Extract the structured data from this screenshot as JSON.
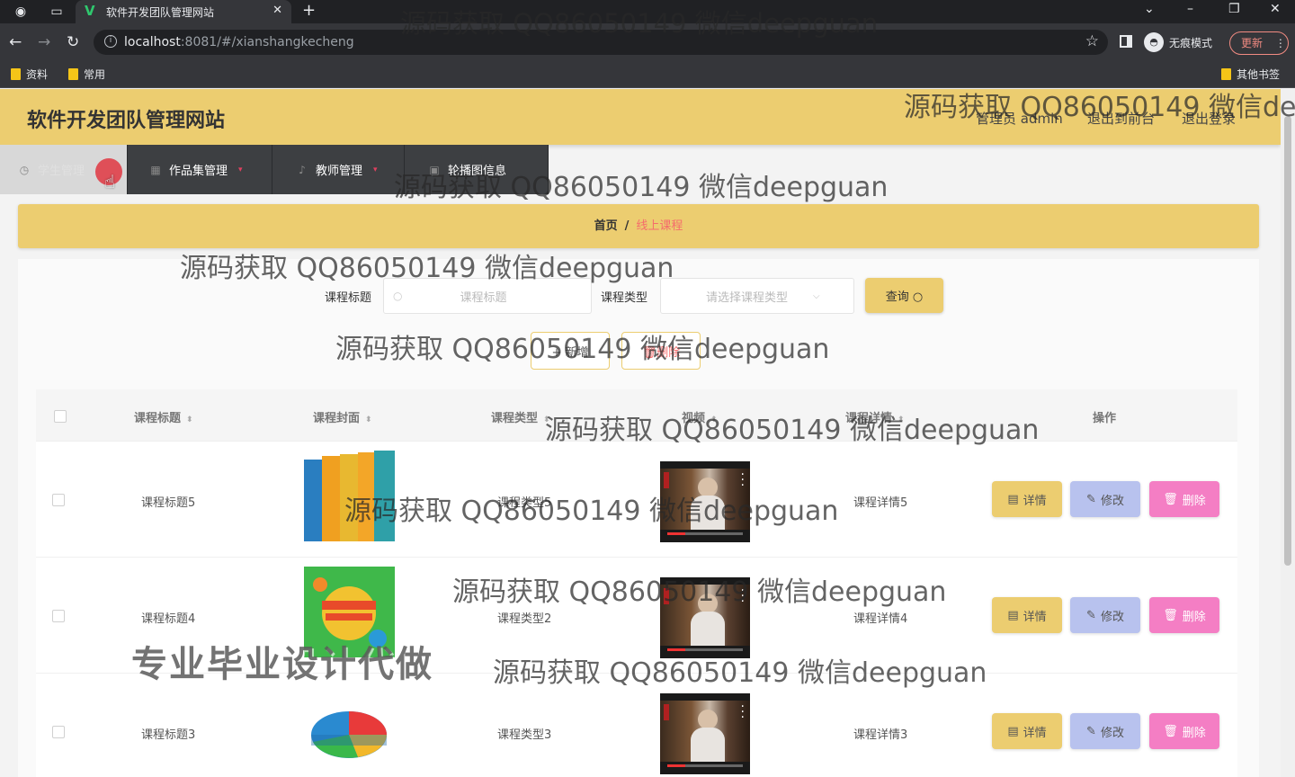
{
  "browser": {
    "tab_title": "软件开发团队管理网站",
    "url_host": "localhost",
    "url_rest": ":8081/#/xianshangkecheng",
    "incognito_label": "无痕模式",
    "update_label": "更新",
    "bookmarks": [
      "资料",
      "常用"
    ],
    "other_bookmarks": "其他书签"
  },
  "header": {
    "title": "软件开发团队管理网站",
    "user": "管理员 admin",
    "to_front": "退出到前台",
    "logout": "退出登录"
  },
  "menu": [
    {
      "label": "学生管理",
      "icon": "clock-icon"
    },
    {
      "label": "作品集管理",
      "icon": "grid-icon"
    },
    {
      "label": "教师管理",
      "icon": "mic-icon"
    },
    {
      "label": "轮播图信息",
      "icon": "image-icon"
    }
  ],
  "breadcrumb": {
    "home": "首页",
    "sep": "/",
    "current": "线上课程"
  },
  "search": {
    "title_label": "课程标题",
    "title_placeholder": "课程标题",
    "type_label": "课程类型",
    "type_placeholder": "请选择课程类型",
    "query_btn": "查询"
  },
  "actions": {
    "add": "+ 新增",
    "delete": "删除"
  },
  "table": {
    "headers": [
      "课程标题",
      "课程封面",
      "课程类型",
      "视频",
      "课程详情",
      "操作"
    ],
    "rows": [
      {
        "title": "课程标题5",
        "type": "课程类型5",
        "detail": "课程详情5"
      },
      {
        "title": "课程标题4",
        "type": "课程类型2",
        "detail": "课程详情4"
      },
      {
        "title": "课程标题3",
        "type": "课程类型3",
        "detail": "课程详情3"
      }
    ],
    "btn_detail": "详情",
    "btn_edit": "修改",
    "btn_delete": "删除"
  },
  "watermarks": {
    "qq": "源码获取 QQ86050149 微信deepguan",
    "pro": "专业毕业设计代做"
  },
  "colors": {
    "accent": "#eccd70",
    "danger": "#f56c6c",
    "edit": "#b8c2ee",
    "delete": "#f47ec4"
  }
}
